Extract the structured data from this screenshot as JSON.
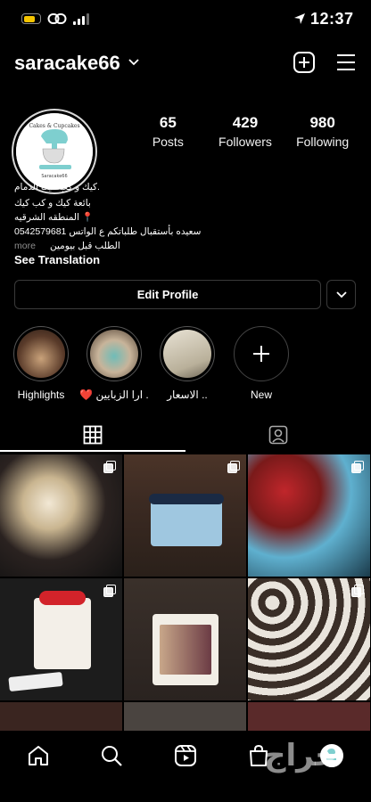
{
  "status_bar": {
    "time": "12:37"
  },
  "header": {
    "username": "saracake66"
  },
  "profile": {
    "avatar_text_top": "Cakes & Cupcakes",
    "avatar_text_bottom": "Saracake66",
    "stats": [
      {
        "number": "65",
        "label": "Posts"
      },
      {
        "number": "429",
        "label": "Followers"
      },
      {
        "number": "980",
        "label": "Following"
      }
    ],
    "bio": {
      "line1": "كيك و كب كيك الدمام.",
      "line2": "بائعة كيك و كب كيك",
      "line3": "المنطقه الشرقيه 📍",
      "line4": "سعيده بأستقبال طلباتكم ع الواتس 0542579681",
      "line5": "الطلب قبل بيومين",
      "more": "more"
    },
    "see_translation": "See Translation",
    "edit_profile": "Edit Profile"
  },
  "highlights": [
    {
      "label": "Highlights",
      "color": "#5a3b2a"
    },
    {
      "label": "❤️ ارا الزبايين .",
      "color": "#8a7560"
    },
    {
      "label": "الاسعار ..",
      "color": "#cfc8b8"
    },
    {
      "label": "New"
    }
  ],
  "grid": [
    {
      "name": "post-graduation-cupcakes",
      "bg": "#2a2220",
      "multi": true
    },
    {
      "name": "post-drip-cake",
      "bg": "#3b2a22",
      "multi": true
    },
    {
      "name": "post-superman-cupcakes",
      "bg": "#5a1a1a",
      "multi": true
    },
    {
      "name": "post-heart-cake",
      "bg": "#1c1c1c",
      "multi": true
    },
    {
      "name": "post-photo-cake",
      "bg": "#2a2320",
      "multi": false
    },
    {
      "name": "post-cupcake-box",
      "bg": "#3a3530",
      "multi": true
    }
  ],
  "icons": {
    "grid_tab": "grid-icon",
    "tagged_tab": "tagged-icon",
    "home": "home-icon",
    "search": "search-icon",
    "reels": "reels-icon",
    "shop": "shop-icon"
  },
  "watermark": "حراج"
}
